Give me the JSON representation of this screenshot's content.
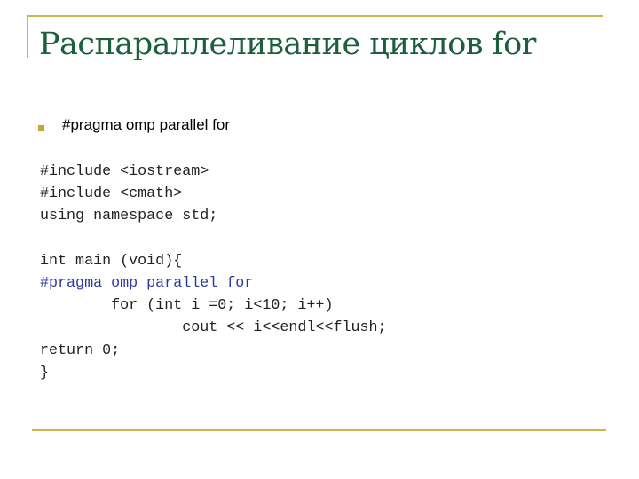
{
  "slide": {
    "title": "Распараллеливание циклов for",
    "bullet": "#pragma omp parallel for",
    "code_lines": [
      {
        "text": "#include <iostream>",
        "kind": "normal"
      },
      {
        "text": "#include <cmath>",
        "kind": "normal"
      },
      {
        "text": "using namespace std;",
        "kind": "normal"
      },
      {
        "text": "",
        "kind": "normal"
      },
      {
        "text": "int main (void){",
        "kind": "normal"
      },
      {
        "text": "#pragma omp parallel for",
        "kind": "pragma"
      },
      {
        "text": "        for (int i =0; i<10; i++)",
        "kind": "normal"
      },
      {
        "text": "                cout << i<<endl<<flush;",
        "kind": "normal"
      },
      {
        "text": "return 0;",
        "kind": "normal"
      },
      {
        "text": "}",
        "kind": "normal"
      }
    ]
  },
  "colors": {
    "title": "#1d5e3e",
    "accent_rule": "#c8b74a",
    "pragma": "#2a3a9a"
  }
}
